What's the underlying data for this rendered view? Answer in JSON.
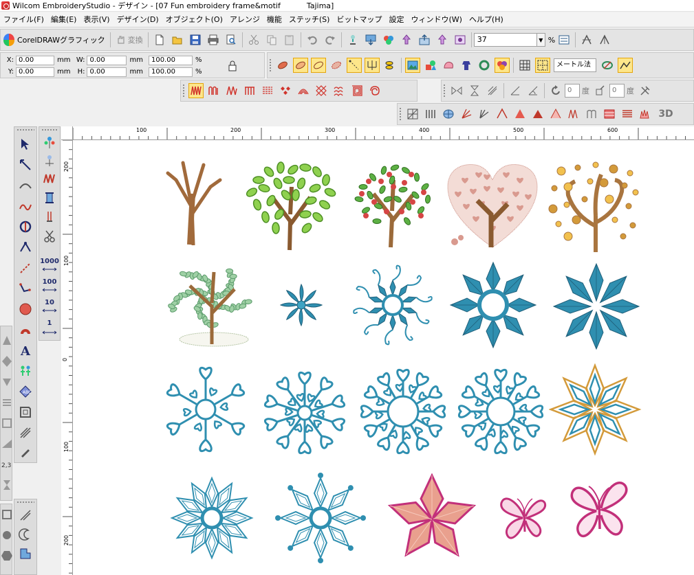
{
  "window": {
    "title": "Wilcom EmbroideryStudio - デザイン - [07 Fun embroidery frame&motif",
    "title_tail": "Tajima]"
  },
  "menu": {
    "items": [
      "ファイル(F)",
      "編集(E)",
      "表示(V)",
      "デザイン(D)",
      "オブジェクト(O)",
      "アレンジ",
      "機能",
      "ステッチ(S)",
      "ビットマップ",
      "設定",
      "ウィンドウ(W)",
      "ヘルプ(H)"
    ]
  },
  "toolbar": {
    "coreldraw_label": "CorelDRAWグラフィック",
    "convert_label": "変換",
    "zoom_value": "37",
    "zoom_unit": "%"
  },
  "coords": {
    "x_label": "X:",
    "x_value": "0.00",
    "x_unit": "mm",
    "y_label": "Y:",
    "y_value": "0.00",
    "y_unit": "mm",
    "w_label": "W:",
    "w_value": "0.00",
    "w_unit": "mm",
    "h_label": "H:",
    "h_value": "0.00",
    "h_unit": "mm",
    "sx_value": "100.00",
    "sx_unit": "%",
    "sy_value": "100.00",
    "sy_unit": "%"
  },
  "stitch_toolbar": {
    "method": "メートル法",
    "angle1": "0",
    "angle1_unit": "度",
    "angle2": "0",
    "angle2_unit": "度",
    "label_3d": "3D"
  },
  "rulers": {
    "h_labels": [
      "100",
      "200",
      "300",
      "400",
      "500",
      "600"
    ],
    "v_labels": [
      "200",
      "100",
      "0",
      "100",
      "200"
    ]
  },
  "left_steps": [
    "1000",
    "100",
    "10",
    "1"
  ],
  "left_extra": "2,3",
  "colors": {
    "trunk": "#a16a3b",
    "leaf_green": "#6fbf3f",
    "apple_red": "#d64545",
    "heart_pink": "#d99a8f",
    "teal": "#2f8fb0",
    "gold": "#d39a3a",
    "magenta": "#c2307a",
    "star_pink": "#e9a08e"
  },
  "motifs": [
    "bare-tree",
    "heart-leaf-tree",
    "apple-tree",
    "heart-blossom-tree",
    "gold-swirl-tree",
    "green-bushy-tree",
    "small-swirl-flower",
    "tendril-snowflake",
    "teal-diamond-snowflake-a",
    "teal-diamond-snowflake-b",
    "heart-snowflake-a",
    "heart-snowflake-b",
    "heart-snowflake-c",
    "heart-snowflake-d",
    "gold-teal-star",
    "outline-snowflake-a",
    "outline-snowflake-b",
    "pink-star",
    "butterfly-small",
    "butterfly-large"
  ]
}
